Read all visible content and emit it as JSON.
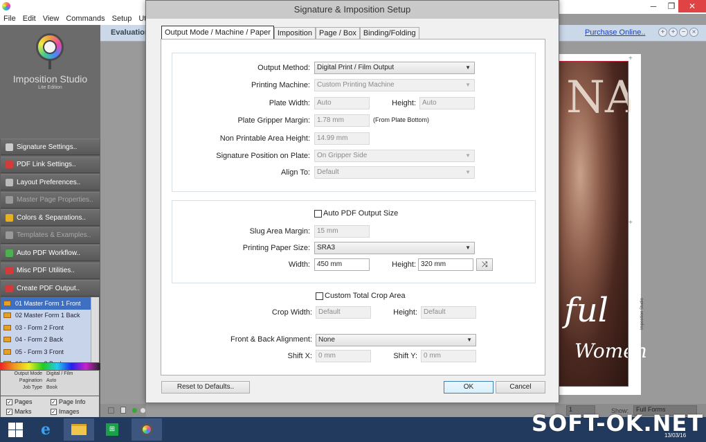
{
  "window": {
    "menu": [
      "File",
      "Edit",
      "View",
      "Commands",
      "Setup",
      "Utiliti"
    ],
    "minimize": "─",
    "maximize": "❐",
    "close": "✕",
    "eval_text": "Evaluation",
    "purchase_link": "Purchase Online.."
  },
  "sidebar": {
    "logo_title": "Imposition Studio",
    "logo_subtitle": "Lite Edition",
    "buttons": [
      {
        "label": "Signature Settings..",
        "enabled": true,
        "icon": "grid-icon",
        "color": "#cccccc"
      },
      {
        "label": "PDF Link Settings..",
        "enabled": true,
        "icon": "pdf-icon",
        "color": "#d33b3b"
      },
      {
        "label": "Layout Preferences..",
        "enabled": true,
        "icon": "gear-icon",
        "color": "#bbbbbb"
      },
      {
        "label": "Master Page Properties..",
        "enabled": false,
        "icon": "page-icon",
        "color": "#999999"
      },
      {
        "label": "Colors & Separations..",
        "enabled": true,
        "icon": "colors-icon",
        "color": "#e8b020"
      },
      {
        "label": "Templates & Examples..",
        "enabled": false,
        "icon": "template-icon",
        "color": "#999999"
      },
      {
        "label": "Auto PDF Workflow..",
        "enabled": true,
        "icon": "workflow-icon",
        "color": "#4caf50"
      },
      {
        "label": "Misc PDF Utilities..",
        "enabled": true,
        "icon": "utility-icon",
        "color": "#d33b3b"
      },
      {
        "label": "Create PDF Output..",
        "enabled": true,
        "icon": "output-icon",
        "color": "#d33b3b"
      }
    ],
    "forms": [
      "01 Master Form 1 Front",
      "02 Master Form 1 Back",
      "03 - Form 2 Front",
      "04 - Form 2 Back",
      "05 - Form 3 Front",
      "06 - Form 3 Back"
    ],
    "selected_form": 0,
    "info": [
      {
        "key": "Output Mode",
        "value": "Digital / Film"
      },
      {
        "key": "Pagination",
        "value": "Auto"
      },
      {
        "key": "Job Type",
        "value": "Book"
      }
    ],
    "checks": [
      {
        "label": "Pages",
        "checked": true
      },
      {
        "label": "Page Info",
        "checked": true
      },
      {
        "label": "Marks",
        "checked": true
      },
      {
        "label": "Images",
        "checked": true
      }
    ]
  },
  "preview": {
    "masthead": "NA",
    "script_text": "ful",
    "women_text": "Women",
    "spine_text": "Imposition Studio",
    "page_select": "1",
    "show_label": "Show:",
    "show_value": "Full Forms"
  },
  "taskbar": {
    "watermark": "SOFT-OK.NET",
    "date": "13/03/16"
  },
  "dialog": {
    "title": "Signature & Imposition Setup",
    "tabs": [
      "Output Mode / Machine / Paper",
      "Imposition",
      "Page / Box",
      "Binding/Folding"
    ],
    "active_tab": 0,
    "output_method_label": "Output Method:",
    "output_method_value": "Digital Print / Film Output",
    "printing_machine_label": "Printing Machine:",
    "printing_machine_value": "Custom Printing Machine",
    "plate_width_label": "Plate Width:",
    "plate_width_value": "Auto",
    "plate_height_label": "Height:",
    "plate_height_value": "Auto",
    "gripper_margin_label": "Plate Gripper Margin:",
    "gripper_margin_value": "1.78 mm",
    "gripper_margin_note": "(From Plate Bottom)",
    "non_printable_label": "Non Printable Area Height:",
    "non_printable_value": "14.99 mm",
    "sig_position_label": "Signature Position on Plate:",
    "sig_position_value": "On Gripper Side",
    "align_to_label": "Align To:",
    "align_to_value": "Default",
    "auto_pdf_label": "Auto PDF Output Size",
    "auto_pdf_checked": false,
    "slug_margin_label": "Slug Area Margin:",
    "slug_margin_value": "15 mm",
    "paper_size_label": "Printing Paper Size:",
    "paper_size_value": "SRA3",
    "paper_width_label": "Width:",
    "paper_width_value": "450 mm",
    "paper_height_label": "Height:",
    "paper_height_value": "320 mm",
    "swap_icon": "⤨",
    "custom_crop_label": "Custom Total Crop Area",
    "custom_crop_checked": false,
    "crop_width_label": "Crop Width:",
    "crop_width_value": "Default",
    "crop_height_label": "Height:",
    "crop_height_value": "Default",
    "alignment_label": "Front & Back Alignment:",
    "alignment_value": "None",
    "shift_x_label": "Shift X:",
    "shift_x_value": "0 mm",
    "shift_y_label": "Shift Y:",
    "shift_y_value": "0 mm",
    "reset_button": "Reset to Defaults..",
    "ok_button": "OK",
    "cancel_button": "Cancel",
    "dropdown_arrow": "▼"
  }
}
